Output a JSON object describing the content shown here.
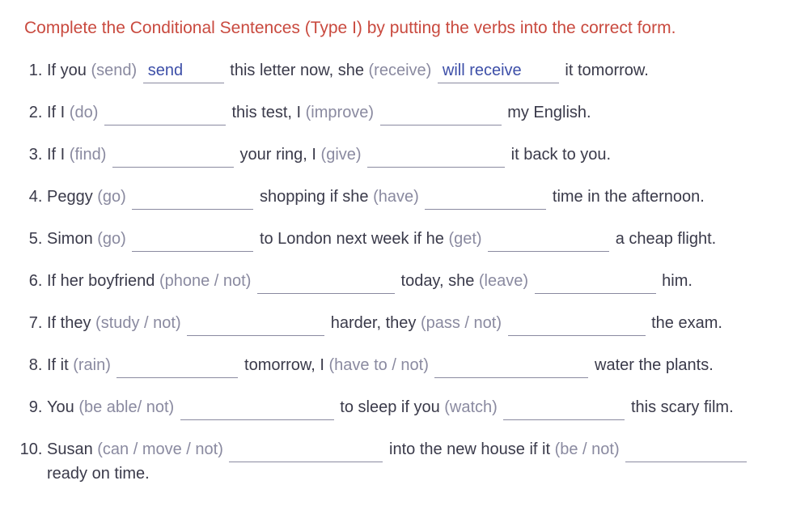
{
  "instruction": "Complete the Conditional Sentences (Type I) by putting the verbs into the correct form.",
  "items": [
    {
      "parts": [
        {
          "t": "text",
          "v": "If you "
        },
        {
          "t": "cue",
          "v": "(send)"
        },
        {
          "t": "text",
          "v": " "
        },
        {
          "t": "blank",
          "answer": "send",
          "w": "100"
        },
        {
          "t": "text",
          "v": " this letter now, she "
        },
        {
          "t": "cue",
          "v": "(receive)"
        },
        {
          "t": "text",
          "v": " "
        },
        {
          "t": "blank",
          "answer": "will receive",
          "w": "150"
        },
        {
          "t": "text",
          "v": " it tomorrow."
        }
      ]
    },
    {
      "parts": [
        {
          "t": "text",
          "v": "If I "
        },
        {
          "t": "cue",
          "v": "(do)"
        },
        {
          "t": "text",
          "v": " "
        },
        {
          "t": "blank",
          "answer": "",
          "w": "150"
        },
        {
          "t": "text",
          "v": " this test, I "
        },
        {
          "t": "cue",
          "v": "(improve)"
        },
        {
          "t": "text",
          "v": " "
        },
        {
          "t": "blank",
          "answer": "",
          "w": "150"
        },
        {
          "t": "text",
          "v": " my English."
        }
      ]
    },
    {
      "parts": [
        {
          "t": "text",
          "v": "If I "
        },
        {
          "t": "cue",
          "v": "(find)"
        },
        {
          "t": "text",
          "v": " "
        },
        {
          "t": "blank",
          "answer": "",
          "w": "150"
        },
        {
          "t": "text",
          "v": " your ring, I "
        },
        {
          "t": "cue",
          "v": "(give)"
        },
        {
          "t": "text",
          "v": " "
        },
        {
          "t": "blank",
          "answer": "",
          "w": "170"
        },
        {
          "t": "text",
          "v": " it back to you."
        }
      ]
    },
    {
      "parts": [
        {
          "t": "text",
          "v": "Peggy "
        },
        {
          "t": "cue",
          "v": "(go)"
        },
        {
          "t": "text",
          "v": " "
        },
        {
          "t": "blank",
          "answer": "",
          "w": "150"
        },
        {
          "t": "text",
          "v": " shopping if she "
        },
        {
          "t": "cue",
          "v": "(have)"
        },
        {
          "t": "text",
          "v": " "
        },
        {
          "t": "blank",
          "answer": "",
          "w": "150"
        },
        {
          "t": "text",
          "v": " time in the afternoon."
        }
      ]
    },
    {
      "parts": [
        {
          "t": "text",
          "v": "Simon "
        },
        {
          "t": "cue",
          "v": "(go)"
        },
        {
          "t": "text",
          "v": " "
        },
        {
          "t": "blank",
          "answer": "",
          "w": "150"
        },
        {
          "t": "text",
          "v": " to London next week if he "
        },
        {
          "t": "cue",
          "v": "(get)"
        },
        {
          "t": "text",
          "v": " "
        },
        {
          "t": "blank",
          "answer": "",
          "w": "150"
        },
        {
          "t": "text",
          "v": " a cheap flight."
        }
      ]
    },
    {
      "parts": [
        {
          "t": "text",
          "v": "If her boyfriend "
        },
        {
          "t": "cue",
          "v": "(phone / not)"
        },
        {
          "t": "text",
          "v": " "
        },
        {
          "t": "blank",
          "answer": "",
          "w": "170"
        },
        {
          "t": "text",
          "v": " today, she "
        },
        {
          "t": "cue",
          "v": "(leave)"
        },
        {
          "t": "text",
          "v": " "
        },
        {
          "t": "blank",
          "answer": "",
          "w": "150"
        },
        {
          "t": "text",
          "v": " him."
        }
      ]
    },
    {
      "parts": [
        {
          "t": "text",
          "v": "If they "
        },
        {
          "t": "cue",
          "v": "(study / not)"
        },
        {
          "t": "text",
          "v": " "
        },
        {
          "t": "blank",
          "answer": "",
          "w": "170"
        },
        {
          "t": "text",
          "v": " harder, they "
        },
        {
          "t": "cue",
          "v": "(pass / not)"
        },
        {
          "t": "text",
          "v": " "
        },
        {
          "t": "blank",
          "answer": "",
          "w": "170"
        },
        {
          "t": "text",
          "v": " the exam."
        }
      ]
    },
    {
      "parts": [
        {
          "t": "text",
          "v": "If it "
        },
        {
          "t": "cue",
          "v": "(rain)"
        },
        {
          "t": "text",
          "v": " "
        },
        {
          "t": "blank",
          "answer": "",
          "w": "150"
        },
        {
          "t": "text",
          "v": " tomorrow, I "
        },
        {
          "t": "cue",
          "v": "(have to / not)"
        },
        {
          "t": "text",
          "v": " "
        },
        {
          "t": "blank",
          "answer": "",
          "w": "190"
        },
        {
          "t": "text",
          "v": " water the plants."
        }
      ]
    },
    {
      "parts": [
        {
          "t": "text",
          "v": "You "
        },
        {
          "t": "cue",
          "v": "(be able/ not)"
        },
        {
          "t": "text",
          "v": " "
        },
        {
          "t": "blank",
          "answer": "",
          "w": "190"
        },
        {
          "t": "text",
          "v": " to sleep if you "
        },
        {
          "t": "cue",
          "v": "(watch)"
        },
        {
          "t": "text",
          "v": " "
        },
        {
          "t": "blank",
          "answer": "",
          "w": "150"
        },
        {
          "t": "text",
          "v": " this scary film."
        }
      ]
    },
    {
      "parts": [
        {
          "t": "text",
          "v": "Susan "
        },
        {
          "t": "cue",
          "v": "(can / move / not)"
        },
        {
          "t": "text",
          "v": " "
        },
        {
          "t": "blank",
          "answer": "",
          "w": "190"
        },
        {
          "t": "text",
          "v": " into the new house if it "
        },
        {
          "t": "cue",
          "v": "(be / not)"
        },
        {
          "t": "text",
          "v": " "
        },
        {
          "t": "blank",
          "answer": "",
          "w": "150"
        },
        {
          "t": "text",
          "v": " ready on time."
        }
      ]
    }
  ]
}
